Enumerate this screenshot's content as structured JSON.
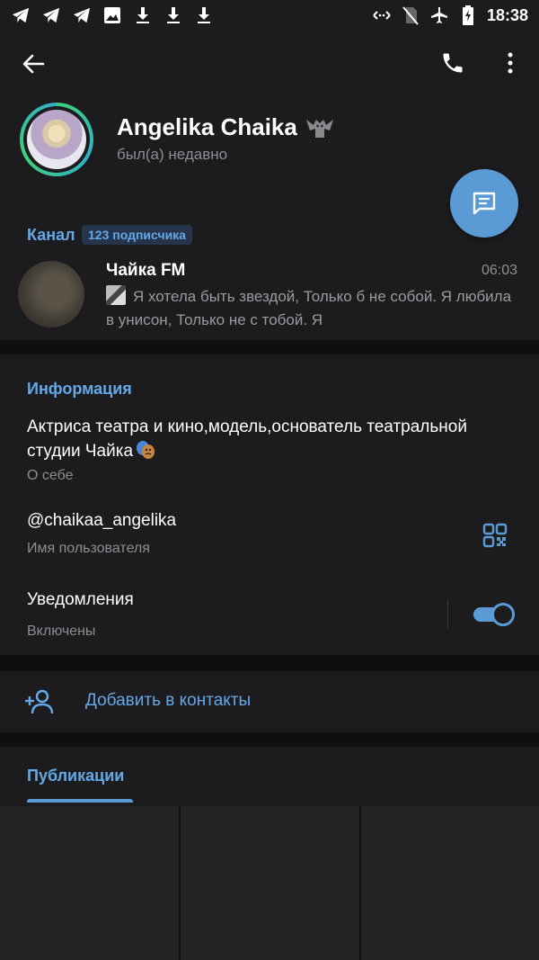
{
  "status_bar": {
    "time": "18:38",
    "left_icons": [
      "telegram-icon",
      "telegram-icon",
      "telegram-icon",
      "image-icon",
      "download-icon",
      "download-icon",
      "download-icon"
    ],
    "right_icons": [
      "data-saver-icon",
      "no-sim-icon",
      "airplane-icon",
      "battery-charging-icon"
    ]
  },
  "profile": {
    "name": "Angelika Chaika",
    "status": "был(а) недавно"
  },
  "channel": {
    "section_label": "Канал",
    "subscribers_badge": "123 подписчика",
    "title": "Чайка FM",
    "time": "06:03",
    "message": "Я хотела быть звездой,  Только б не собой. Я любила в унисон, Только не с тобой.  Я"
  },
  "info": {
    "section_label": "Информация",
    "bio": "Актриса театра и кино,модель,основатель театральной студии Чайка",
    "bio_caption": "О себе",
    "username": "@chaikaa_angelika",
    "username_caption": "Имя пользователя",
    "notifications_label": "Уведомления",
    "notifications_caption": "Включены",
    "notifications_on": true
  },
  "add_contact": {
    "label": "Добавить в контакты"
  },
  "publications": {
    "tab_label": "Публикации"
  },
  "colors": {
    "accent": "#5b9bd5",
    "accent_text": "#64a8e8",
    "surface": "#1c1c1e",
    "background": "#0f0f0f",
    "secondary_text": "#8d8d93"
  }
}
